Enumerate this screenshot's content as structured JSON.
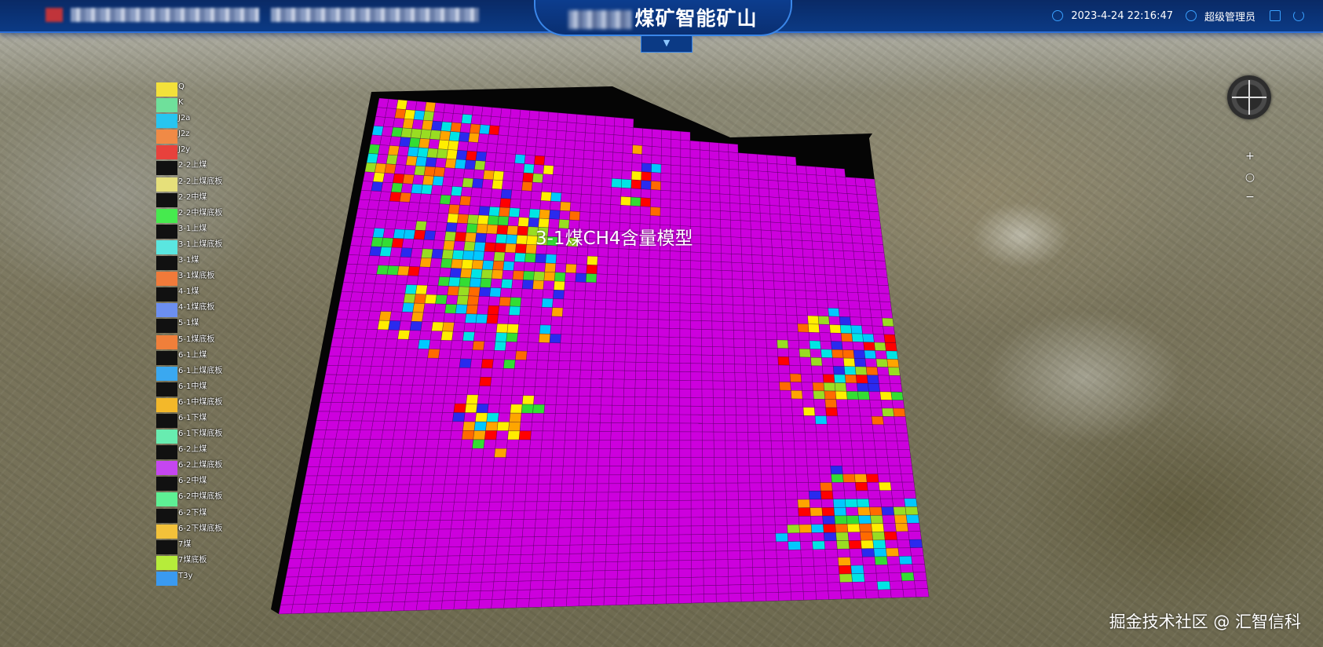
{
  "header": {
    "title": "煤矿智能矿山",
    "datetime": "2023-4-24 22:16:47",
    "user": "超级管理员",
    "dropdown_glyph": "▼"
  },
  "map": {
    "model_title": "3-1煤CH4含量模型"
  },
  "legend": {
    "items": [
      {
        "label": "Q",
        "color": "#f3e13a"
      },
      {
        "label": "K",
        "color": "#6fe09b"
      },
      {
        "label": "J2a",
        "color": "#27c5f0"
      },
      {
        "label": "J2z",
        "color": "#f08a46"
      },
      {
        "label": "J2y",
        "color": "#e8413c"
      },
      {
        "label": "2-2上煤",
        "color": "#111111"
      },
      {
        "label": "2-2上煤底板",
        "color": "#e6e07a"
      },
      {
        "label": "2-2中煤",
        "color": "#111111"
      },
      {
        "label": "2-2中煤底板",
        "color": "#46ea4e"
      },
      {
        "label": "3-1上煤",
        "color": "#111111"
      },
      {
        "label": "3-1上煤底板",
        "color": "#5ae6e0"
      },
      {
        "label": "3-1煤",
        "color": "#111111"
      },
      {
        "label": "3-1煤底板",
        "color": "#f07a3a"
      },
      {
        "label": "4-1煤",
        "color": "#111111"
      },
      {
        "label": "4-1煤底板",
        "color": "#6c8ff0"
      },
      {
        "label": "5-1煤",
        "color": "#111111"
      },
      {
        "label": "5-1煤底板",
        "color": "#f07f3a"
      },
      {
        "label": "6-1上煤",
        "color": "#111111"
      },
      {
        "label": "6-1上煤底板",
        "color": "#3aa8f0"
      },
      {
        "label": "6-1中煤",
        "color": "#111111"
      },
      {
        "label": "6-1中煤底板",
        "color": "#f3b82a"
      },
      {
        "label": "6-1下煤",
        "color": "#111111"
      },
      {
        "label": "6-1下煤底板",
        "color": "#68ecb0"
      },
      {
        "label": "6-2上煤",
        "color": "#111111"
      },
      {
        "label": "6-2上煤底板",
        "color": "#c546f0"
      },
      {
        "label": "6-2中煤",
        "color": "#111111"
      },
      {
        "label": "6-2中煤底板",
        "color": "#5ef094"
      },
      {
        "label": "6-2下煤",
        "color": "#111111"
      },
      {
        "label": "6-2下煤底板",
        "color": "#f3c23a"
      },
      {
        "label": "7煤",
        "color": "#111111"
      },
      {
        "label": "7煤底板",
        "color": "#b6ec3a"
      },
      {
        "label": "T3y",
        "color": "#3a9af0"
      }
    ]
  },
  "model_colors": {
    "base": "#cc00dd",
    "palette": [
      "#ff0000",
      "#ffee00",
      "#00e5e5",
      "#00c8ff",
      "#33dd33",
      "#2a2aee",
      "#ffa500",
      "#ff6a00",
      "#99dd22"
    ]
  },
  "controls": {
    "zoom_in": "+",
    "reset": "○",
    "zoom_out": "−"
  },
  "watermark": "掘金技术社区 @ 汇智信科"
}
